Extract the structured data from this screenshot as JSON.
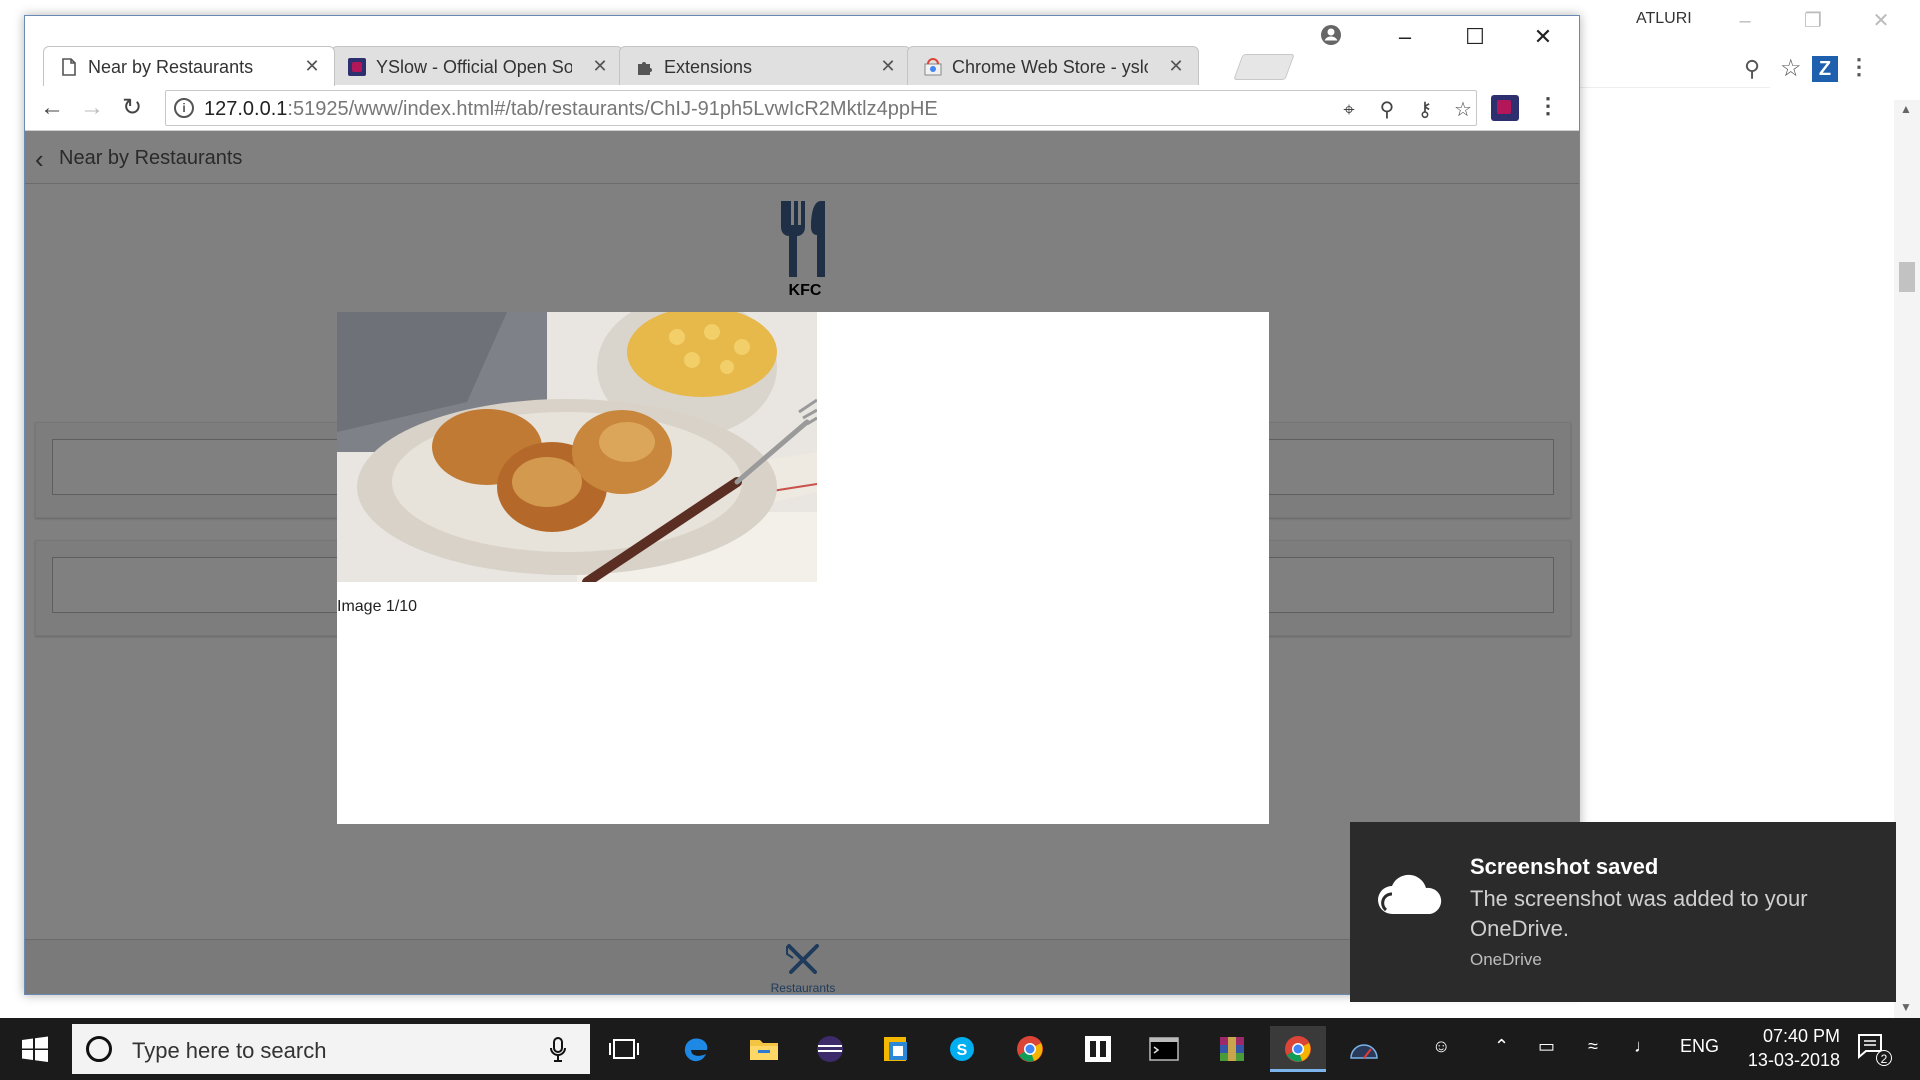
{
  "background_window": {
    "user_name": "ATLURI"
  },
  "browser": {
    "tabs": [
      {
        "title": "Near by Restaurants",
        "icon": "page-icon",
        "active": true
      },
      {
        "title": "YSlow - Official Open Source",
        "icon": "yslow-icon",
        "active": false
      },
      {
        "title": "Extensions",
        "icon": "puzzle-icon",
        "active": false
      },
      {
        "title": "Chrome Web Store - yslow",
        "icon": "webstore-icon",
        "active": false
      }
    ],
    "url_host": "127.0.0.1",
    "url_rest": ":51925/www/index.html#/tab/restaurants/ChIJ-91ph5LvwIcR2Mktlz4ppHE"
  },
  "app": {
    "header_title": "Near by Restaurants",
    "restaurant_name": "KFC",
    "footer_tab_label": "Restaurants"
  },
  "modal": {
    "caption": "Image 1/10"
  },
  "toast": {
    "title": "Screenshot saved",
    "body": "The screenshot was added to your OneDrive.",
    "source": "OneDrive"
  },
  "taskbar": {
    "search_placeholder": "Type here to search",
    "language": "ENG",
    "time": "07:40 PM",
    "date": "13-03-2018",
    "notification_count": "2"
  },
  "colors": {
    "overlay_gray": "#808080",
    "toast_bg": "#2b2b2b",
    "taskbar_bg": "#1b1b1b",
    "footer_icon": "#1e3b5c"
  }
}
